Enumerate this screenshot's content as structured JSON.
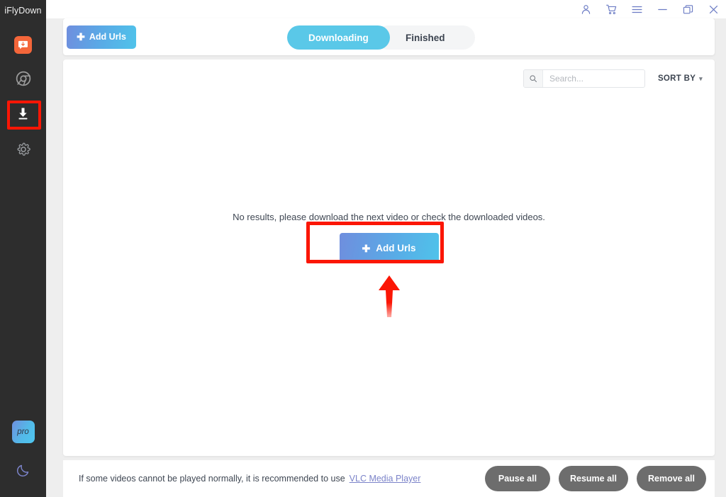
{
  "app": {
    "name": "iFlyDown"
  },
  "titlebar": {
    "buttons": [
      {
        "name": "account-icon",
        "label": "Account"
      },
      {
        "name": "cart-icon",
        "label": "Cart"
      },
      {
        "name": "menu-icon",
        "label": "Menu"
      },
      {
        "name": "minimize-icon",
        "label": "Minimize"
      },
      {
        "name": "restore-icon",
        "label": "Restore"
      },
      {
        "name": "close-icon",
        "label": "Close"
      }
    ]
  },
  "sidebar": {
    "items": [
      {
        "icon": "chat-download-icon",
        "label": "Messages",
        "active": false
      },
      {
        "icon": "browser-icon",
        "label": "Browser",
        "active": false
      },
      {
        "icon": "download-icon",
        "label": "Downloads",
        "active": true
      },
      {
        "icon": "gear-icon",
        "label": "Settings",
        "active": false
      }
    ],
    "pro_label": "pro",
    "theme_toggle": "moon-icon"
  },
  "header": {
    "add_urls_label": "Add Urls",
    "tabs": [
      {
        "label": "Downloading",
        "active": true
      },
      {
        "label": "Finished",
        "active": false
      }
    ]
  },
  "toolbar": {
    "search_placeholder": "Search...",
    "search_value": "",
    "sort_by_label": "SORT BY"
  },
  "main": {
    "empty_message": "No results, please download the next video or check the downloaded videos.",
    "cta_label": "Add Urls"
  },
  "footer": {
    "notice_text": "If some videos cannot be played normally, it is recommended to use",
    "link_label": "VLC Media Player",
    "buttons": [
      {
        "label": "Pause all"
      },
      {
        "label": "Resume all"
      },
      {
        "label": "Remove all"
      }
    ]
  },
  "colors": {
    "accent_cyan": "#5ac8e8",
    "accent_gradient_start": "#6f8ede",
    "accent_gradient_end": "#4fc3ea",
    "sidebar_bg": "#2d2d2d",
    "chat_badge": "#f4663a",
    "annotation_red": "#fb1605",
    "link": "#7b83c9",
    "footer_button": "#6d6d6d"
  }
}
